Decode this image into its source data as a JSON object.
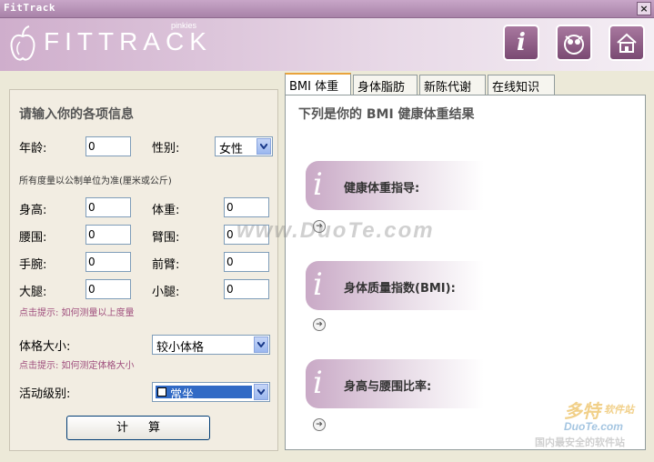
{
  "window": {
    "title": "FitTrack",
    "close_label": "×"
  },
  "header": {
    "logo_text": "FITTRACK",
    "logo_sub": "pinkies",
    "buttons": [
      "info",
      "owl",
      "home"
    ]
  },
  "form": {
    "heading": "请输入你的各项信息",
    "age_label": "年龄:",
    "age_value": "0",
    "gender_label": "性别:",
    "gender_value": "女性",
    "unit_note": "所有度量以公制单位为准(厘米或公斤)",
    "height_label": "身高:",
    "height_value": "0",
    "weight_label": "体重:",
    "weight_value": "0",
    "waist_label": "腰围:",
    "waist_value": "0",
    "arm_label": "臂围:",
    "arm_value": "0",
    "wrist_label": "手腕:",
    "wrist_value": "0",
    "forearm_label": "前臂:",
    "forearm_value": "0",
    "thigh_label": "大腿:",
    "thigh_value": "0",
    "calf_label": "小腿:",
    "calf_value": "0",
    "hint_measure": "点击提示: 如何测量以上度量",
    "frame_label": "体格大小:",
    "frame_value": "较小体格",
    "hint_frame": "点击提示: 如何测定体格大小",
    "activity_label": "活动级别:",
    "activity_value": "常坐",
    "calc_label": "计算"
  },
  "tabs": [
    "BMI 体重",
    "身体脂肪",
    "新陈代谢",
    "在线知识"
  ],
  "results": {
    "title": "下列是你的 BMI 健康体重结果",
    "cards": [
      "健康体重指导:",
      "身体质量指数(BMI):",
      "身高与腰围比率:"
    ]
  },
  "watermark": {
    "center": "www.DuoTe.com",
    "brand": "多特",
    "brand_sub": "软件站",
    "site": "DuoTe.com",
    "slogan": "国内最安全的软件站"
  },
  "colors": {
    "accent": "#a0507e",
    "header": "#cfaecc"
  }
}
